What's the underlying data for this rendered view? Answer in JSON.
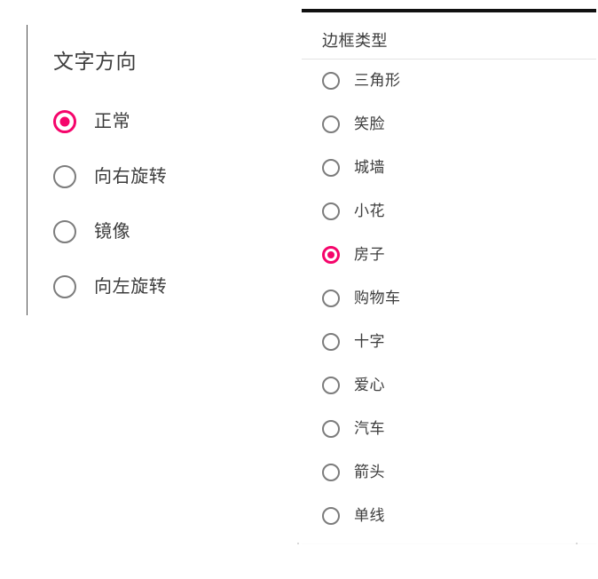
{
  "colors": {
    "accent": "#f5056b",
    "radio_off_border": "#7c7c7c",
    "text": "#3c3c3c",
    "rule_dark": "#111111",
    "rule_light": "#e3e3e3",
    "left_rule": "#4a4a4a"
  },
  "left_panel": {
    "title": "文字方向",
    "selected_index": 0,
    "options": [
      {
        "label": "正常",
        "selected": true,
        "icon": "radio-selected-icon"
      },
      {
        "label": "向右旋转",
        "selected": false,
        "icon": "radio-unselected-icon"
      },
      {
        "label": "镜像",
        "selected": false,
        "icon": "radio-unselected-icon"
      },
      {
        "label": "向左旋转",
        "selected": false,
        "icon": "radio-unselected-icon"
      }
    ]
  },
  "right_panel": {
    "title": "边框类型",
    "selected_index": 4,
    "options": [
      {
        "label": "三角形",
        "selected": false,
        "icon": "radio-unselected-icon"
      },
      {
        "label": "笑脸",
        "selected": false,
        "icon": "radio-unselected-icon"
      },
      {
        "label": "城墙",
        "selected": false,
        "icon": "radio-unselected-icon"
      },
      {
        "label": "小花",
        "selected": false,
        "icon": "radio-unselected-icon"
      },
      {
        "label": "房子",
        "selected": true,
        "icon": "radio-selected-icon"
      },
      {
        "label": "购物车",
        "selected": false,
        "icon": "radio-unselected-icon"
      },
      {
        "label": "十字",
        "selected": false,
        "icon": "radio-unselected-icon"
      },
      {
        "label": "爱心",
        "selected": false,
        "icon": "radio-unselected-icon"
      },
      {
        "label": "汽车",
        "selected": false,
        "icon": "radio-unselected-icon"
      },
      {
        "label": "箭头",
        "selected": false,
        "icon": "radio-unselected-icon"
      },
      {
        "label": "单线",
        "selected": false,
        "icon": "radio-unselected-icon"
      }
    ]
  }
}
